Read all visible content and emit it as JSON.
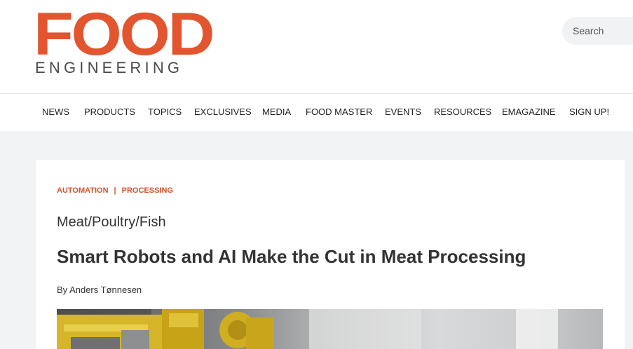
{
  "header": {
    "logo_top": "FOOD",
    "logo_bottom": "ENGINEERING",
    "logo_color": "#e3552f",
    "search_placeholder": "Search"
  },
  "nav": {
    "items": [
      "NEWS",
      "PRODUCTS",
      "TOPICS",
      "EXCLUSIVES",
      "MEDIA",
      "FOOD MASTER",
      "EVENTS",
      "RESOURCES",
      "EMAGAZINE",
      "SIGN UP!"
    ]
  },
  "article": {
    "categories": [
      "AUTOMATION",
      "PROCESSING"
    ],
    "category_separator": "|",
    "kicker": "Meat/Poultry/Fish",
    "title": "Smart Robots and AI Make the Cut in Meat Processing",
    "byline": "By Anders Tønnesen",
    "accent_color": "#d2532c"
  }
}
